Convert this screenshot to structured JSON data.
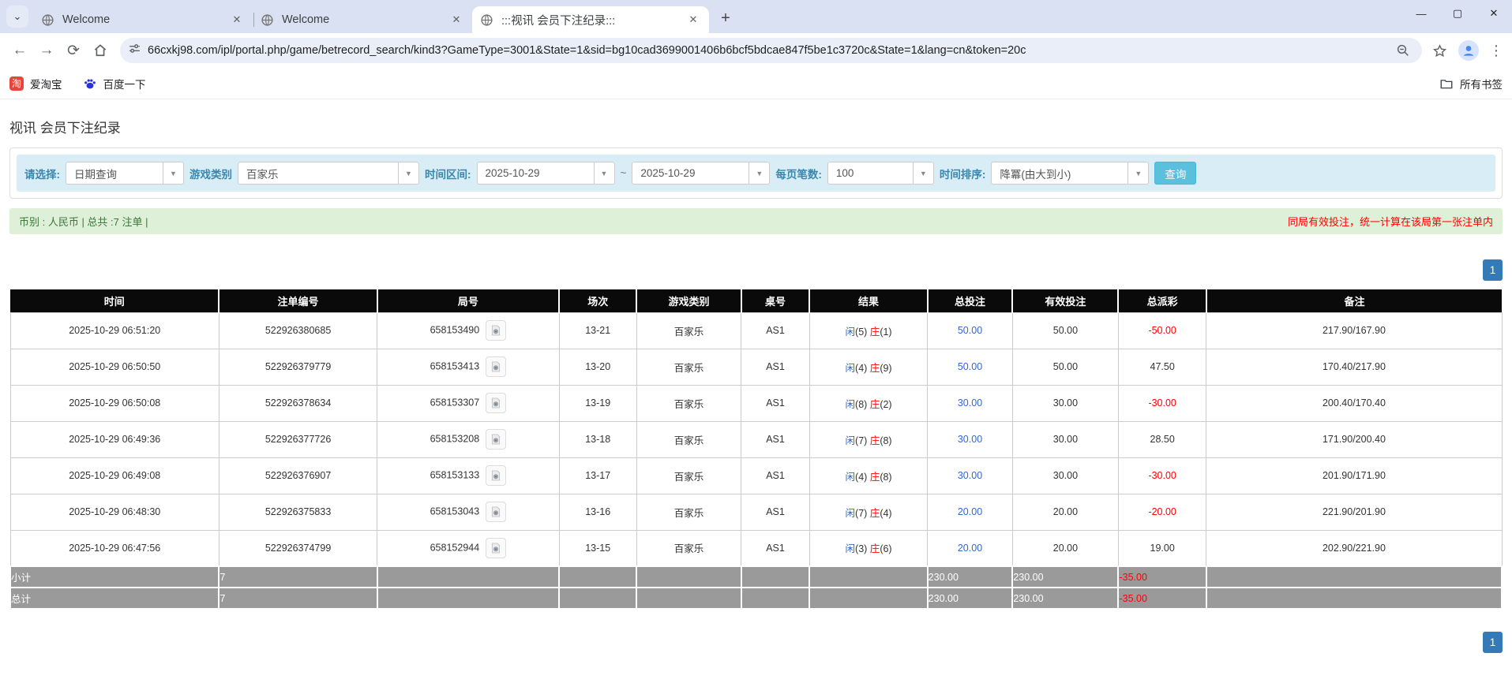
{
  "colors": {
    "accent_blue": "#337ab7",
    "value_blue": "#3366cc",
    "value_red": "#ff0000",
    "filter_bg": "#d9edf7",
    "info_bg": "#dff0d8",
    "header_bg": "#0a0a0a",
    "totals_bg": "#9a9a9a"
  },
  "browser": {
    "tabs": [
      {
        "title": "Welcome"
      },
      {
        "title": "Welcome"
      },
      {
        "title": ":::视讯 会员下注纪录:::"
      }
    ],
    "new_tab_glyph": "+",
    "close_glyph": "✕",
    "chevron_glyph": "⌄",
    "back_glyph": "←",
    "forward_glyph": "→",
    "reload_glyph": "⟳",
    "menu_glyph": "⋮",
    "min_glyph": "—",
    "max_glyph": "▢",
    "url": "66cxkj98.com/ipl/portal.php/game/betrecord_search/kind3?GameType=3001&State=1&sid=bg10cad3699001406b6bcf5bdcae847f5be1c3720c&State=1&lang=cn&token=20c",
    "bookmarks": [
      {
        "label": "爱淘宝",
        "icon_text": "淘"
      },
      {
        "label": "百度一下"
      }
    ],
    "all_bookmarks_label": "所有书签"
  },
  "page": {
    "title": "视讯 会员下注纪录",
    "filters": {
      "select_label": "请选择:",
      "select_value": "日期查询",
      "game_type_label": "游戏类别",
      "game_type_value": "百家乐",
      "time_range_label": "时间区间:",
      "date_from": "2025-10-29",
      "tilde": "~",
      "date_to": "2025-10-29",
      "page_size_label": "每页笔数:",
      "page_size_value": "100",
      "sort_label": "时间排序:",
      "sort_value": "降冪(由大到小)",
      "search_button": "查询",
      "arrow_glyph": "▼"
    },
    "info_bar": {
      "left": "币别 : 人民币 | 总共 :7 注单 |",
      "right": "同局有效投注，统一计算在该局第一张注单内"
    },
    "pagination": {
      "page": "1"
    },
    "table": {
      "headers": [
        "时间",
        "注单编号",
        "局号",
        "场次",
        "游戏类别",
        "桌号",
        "结果",
        "总投注",
        "有效投注",
        "总派彩",
        "备注"
      ],
      "col_widths": [
        "14.0%",
        "10.6%",
        "12.2%",
        "5.2%",
        "7.0%",
        "4.6%",
        "7.9%",
        "5.7%",
        "7.1%",
        "5.9%",
        "19.8%"
      ],
      "rows": [
        {
          "time": "2025-10-29 06:51:20",
          "bet_id": "522926380685",
          "round_id": "658153490",
          "session": "13-21",
          "game": "百家乐",
          "table_no": "AS1",
          "rp": "闲",
          "rpn": "(5) ",
          "rb": "庄",
          "rbn": "(1)",
          "total_bet": "50.00",
          "valid_bet": "50.00",
          "payout": "-50.00",
          "remark": "217.90/167.90"
        },
        {
          "time": "2025-10-29 06:50:50",
          "bet_id": "522926379779",
          "round_id": "658153413",
          "session": "13-20",
          "game": "百家乐",
          "table_no": "AS1",
          "rp": "闲",
          "rpn": "(4) ",
          "rb": "庄",
          "rbn": "(9)",
          "total_bet": "50.00",
          "valid_bet": "50.00",
          "payout": "47.50",
          "remark": "170.40/217.90"
        },
        {
          "time": "2025-10-29 06:50:08",
          "bet_id": "522926378634",
          "round_id": "658153307",
          "session": "13-19",
          "game": "百家乐",
          "table_no": "AS1",
          "rp": "闲",
          "rpn": "(8) ",
          "rb": "庄",
          "rbn": "(2)",
          "total_bet": "30.00",
          "valid_bet": "30.00",
          "payout": "-30.00",
          "remark": "200.40/170.40"
        },
        {
          "time": "2025-10-29 06:49:36",
          "bet_id": "522926377726",
          "round_id": "658153208",
          "session": "13-18",
          "game": "百家乐",
          "table_no": "AS1",
          "rp": "闲",
          "rpn": "(7) ",
          "rb": "庄",
          "rbn": "(8)",
          "total_bet": "30.00",
          "valid_bet": "30.00",
          "payout": "28.50",
          "remark": "171.90/200.40"
        },
        {
          "time": "2025-10-29 06:49:08",
          "bet_id": "522926376907",
          "round_id": "658153133",
          "session": "13-17",
          "game": "百家乐",
          "table_no": "AS1",
          "rp": "闲",
          "rpn": "(4) ",
          "rb": "庄",
          "rbn": "(8)",
          "total_bet": "30.00",
          "valid_bet": "30.00",
          "payout": "-30.00",
          "remark": "201.90/171.90"
        },
        {
          "time": "2025-10-29 06:48:30",
          "bet_id": "522926375833",
          "round_id": "658153043",
          "session": "13-16",
          "game": "百家乐",
          "table_no": "AS1",
          "rp": "闲",
          "rpn": "(7) ",
          "rb": "庄",
          "rbn": "(4)",
          "total_bet": "20.00",
          "valid_bet": "20.00",
          "payout": "-20.00",
          "remark": "221.90/201.90"
        },
        {
          "time": "2025-10-29 06:47:56",
          "bet_id": "522926374799",
          "round_id": "658152944",
          "session": "13-15",
          "game": "百家乐",
          "table_no": "AS1",
          "rp": "闲",
          "rpn": "(3) ",
          "rb": "庄",
          "rbn": "(6)",
          "total_bet": "20.00",
          "valid_bet": "20.00",
          "payout": "19.00",
          "remark": "202.90/221.90"
        }
      ],
      "subtotal": {
        "label": "小计",
        "count": "7",
        "total_bet": "230.00",
        "valid_bet": "230.00",
        "payout": "-35.00"
      },
      "total": {
        "label": "总计",
        "count": "7",
        "total_bet": "230.00",
        "valid_bet": "230.00",
        "payout": "-35.00"
      }
    }
  }
}
